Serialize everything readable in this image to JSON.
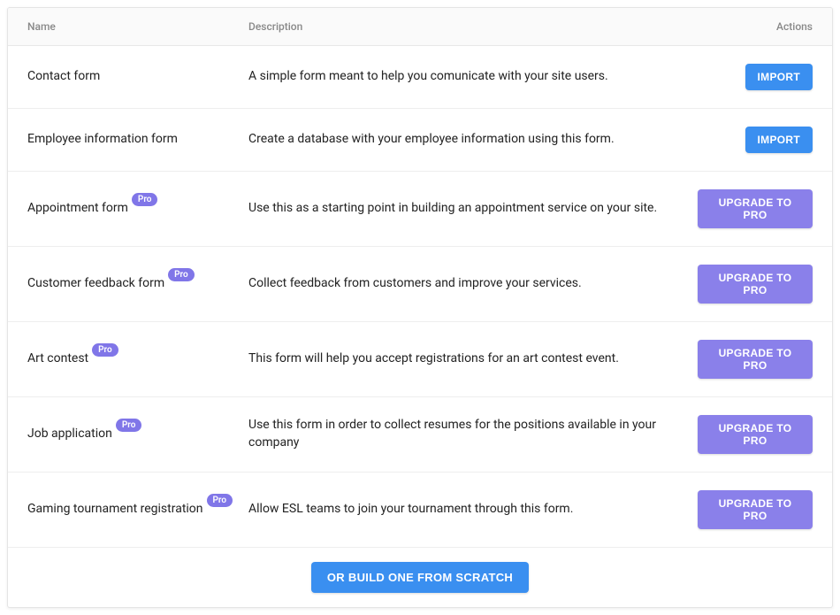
{
  "headers": {
    "name": "Name",
    "description": "Description",
    "actions": "Actions"
  },
  "buttons": {
    "import": "IMPORT",
    "upgrade": "UPGRADE TO PRO",
    "build_scratch": "OR BUILD ONE FROM SCRATCH"
  },
  "badges": {
    "pro": "Pro"
  },
  "rows": [
    {
      "name": "Contact form",
      "description": "A simple form meant to help you comunicate with your site users.",
      "pro": false
    },
    {
      "name": "Employee information form",
      "description": "Create a database with your employee information using this form.",
      "pro": false
    },
    {
      "name": "Appointment form",
      "description": "Use this as a starting point in building an appointment service on your site.",
      "pro": true
    },
    {
      "name": "Customer feedback form",
      "description": "Collect feedback from customers and improve your services.",
      "pro": true
    },
    {
      "name": "Art contest",
      "description": "This form will help you accept registrations for an art contest event.",
      "pro": true
    },
    {
      "name": "Job application",
      "description": "Use this form in order to collect resumes for the positions available in your company",
      "pro": true
    },
    {
      "name": "Gaming tournament registration",
      "description": "Allow ESL teams to join your tournament through this form.",
      "pro": true
    }
  ]
}
